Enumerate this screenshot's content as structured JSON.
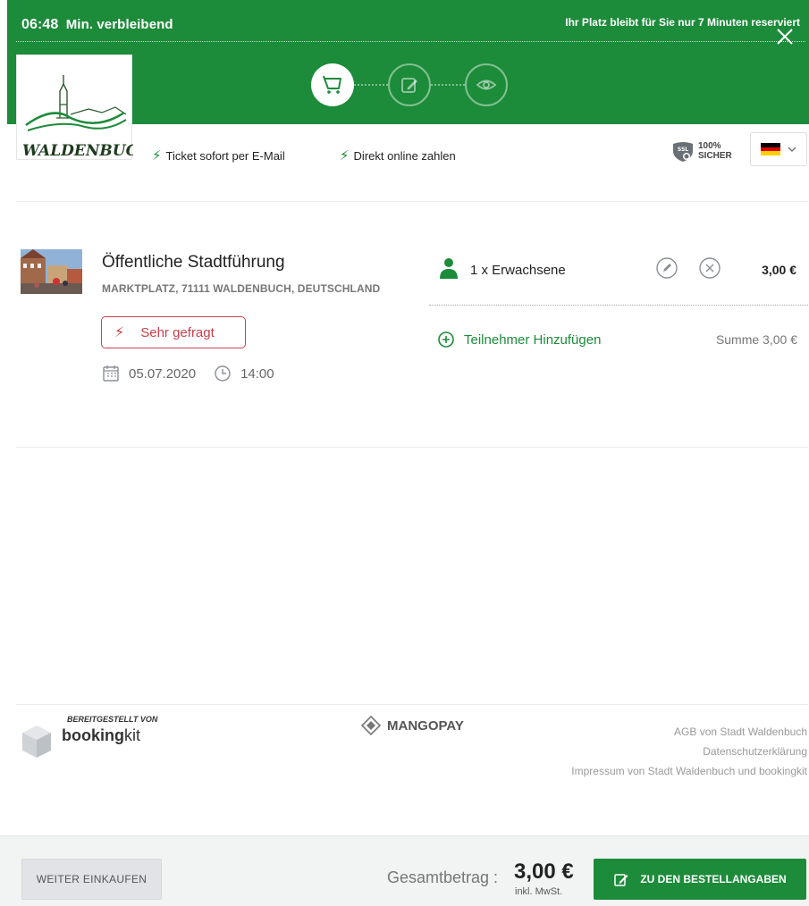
{
  "header": {
    "timer_value": "06:48",
    "timer_label": "Min. verbleibend",
    "reserve_note": "Ihr Platz bleibt für Sie nur 7 Minuten reserviert",
    "steps": [
      "cart-icon",
      "edit-icon",
      "eye-icon"
    ],
    "active_step": 0,
    "brand_color": "#1c8b3a"
  },
  "logo": {
    "text": "WALDENBUCH"
  },
  "info": {
    "email_ticket": "Ticket sofort per E-Mail",
    "online_pay": "Direkt online zahlen",
    "ssl_line1": "100%",
    "ssl_line2": "SICHER",
    "ssl_badge": "SSL",
    "language": "de"
  },
  "event": {
    "title": "Öffentliche Stadtführung",
    "address": "MARKTPLATZ, 71111 WALDENBUCH, DEUTSCHLAND",
    "badge": "Sehr gefragt",
    "date": "05.07.2020",
    "time": "14:00"
  },
  "participants": {
    "line": "1 x Erwachsene",
    "price": "3,00 €",
    "add_label": "Teilnehmer Hinzufügen",
    "sum": "Summe 3,00 €"
  },
  "footer": {
    "provided_by": "BEREITGESTELLT VON",
    "bk_bold": "booking",
    "bk_light": "kit",
    "payment": "MANGOPAY",
    "links": [
      "AGB von Stadt Waldenbuch",
      "Datenschutzerklärung",
      "Impressum von Stadt Waldenbuch und bookingkit"
    ]
  },
  "bottom": {
    "continue_shopping": "WEITER EINKAUFEN",
    "total_label": "Gesamtbetrag :",
    "total_amount": "3,00 €",
    "vat": "inkl. MwSt.",
    "next_button": "ZU DEN BESTELLANGABEN"
  }
}
